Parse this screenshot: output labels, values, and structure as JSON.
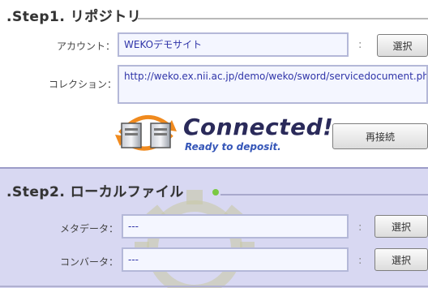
{
  "step1": {
    "title": ".Step1. リポジトリ",
    "account_label": "アカウント：",
    "account_value": "WEKOデモサイト",
    "collection_label": "コレクション：",
    "collection_value": "http://weko.ex.nii.ac.jp/demo/weko/sword/servicedocument.php",
    "separator": ":",
    "select_label": "選択",
    "connected_text": "Connected!",
    "ready_text": "Ready to deposit.",
    "reconnect_label": "再接続"
  },
  "step2": {
    "title": ".Step2. ローカルファイル",
    "metadata_label": "メタデータ：",
    "metadata_value": "---",
    "converter_label": "コンバータ：",
    "converter_value": "---",
    "separator": ":",
    "select_label": "選択"
  },
  "colors": {
    "field_border": "#b4b8d8",
    "field_text": "#2f34a8",
    "step2_band": "#d8d8f2",
    "connected_text": "#2a2a5a",
    "ready_text": "#3556b8"
  }
}
